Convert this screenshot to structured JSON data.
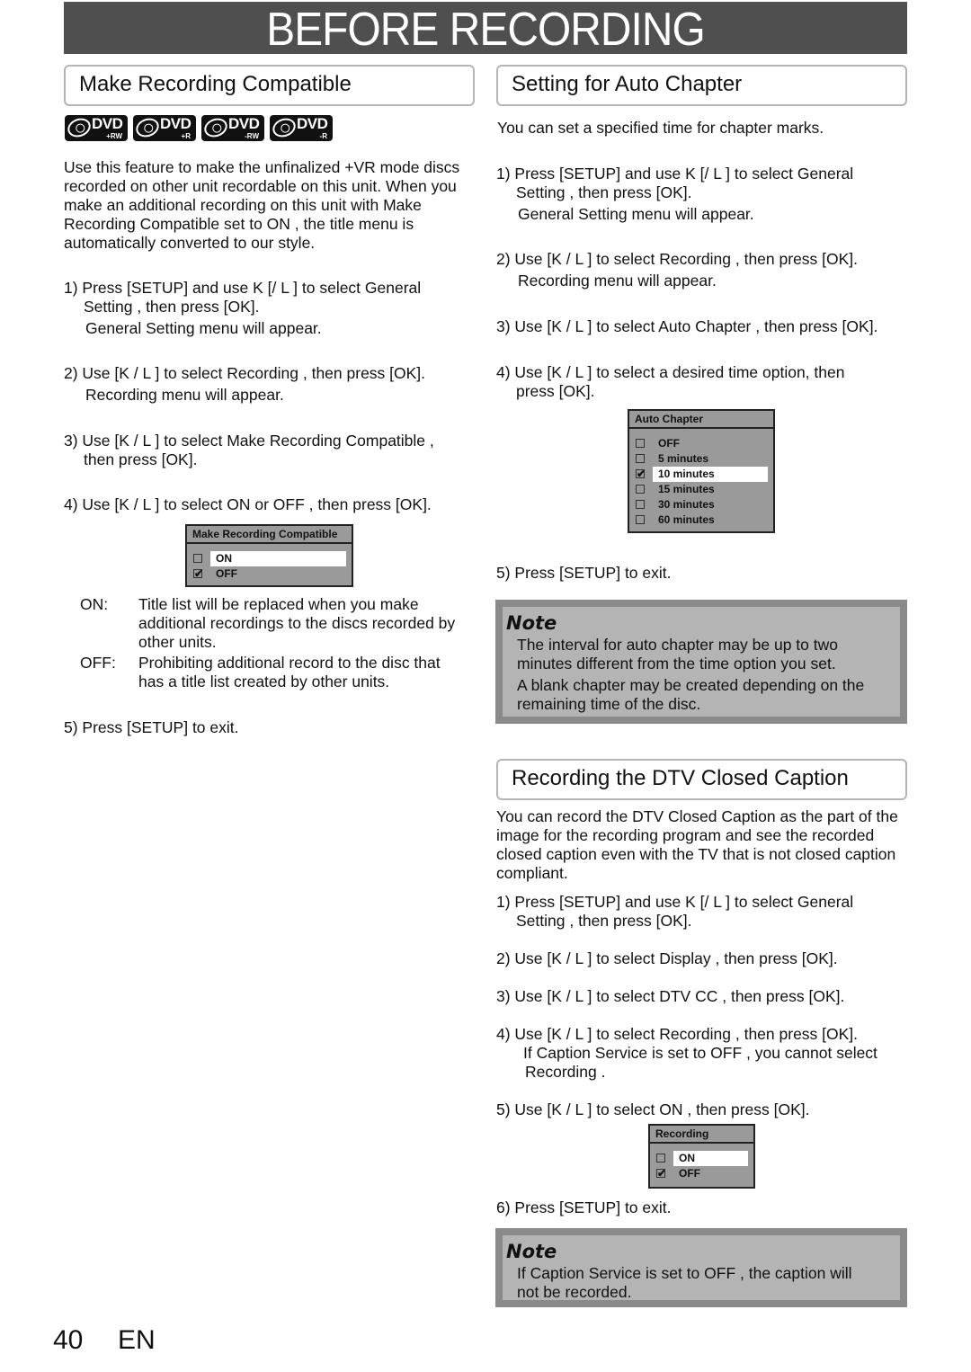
{
  "header": {
    "title": "BEFORE RECORDING"
  },
  "left": {
    "heading": "Make Recording Compatible",
    "disc_icons": [
      {
        "name": "dvd-plus-rw-icon",
        "label": "DVD",
        "sub": "+RW"
      },
      {
        "name": "dvd-plus-r-icon",
        "label": "DVD",
        "sub": "+R"
      },
      {
        "name": "dvd-minus-rw-icon",
        "label": "DVD",
        "sub": "-RW"
      },
      {
        "name": "dvd-minus-r-icon",
        "label": "DVD",
        "sub": "-R"
      }
    ],
    "intro": [
      "Use this feature to make the unfinalized +VR mode discs",
      "recorded on other unit recordable on this unit. When you",
      "make an additional recording on this unit with  Make",
      "Recording Compatible  set to  ON , the title menu is",
      "automatically converted to our style."
    ],
    "steps": [
      {
        "lines": [
          "1) Press [SETUP] and use K [/ L ] to select  General",
          "Setting , then press [OK].",
          "General Setting  menu will appear."
        ]
      },
      {
        "lines": [
          "2) Use [K / L ] to select  Recording , then press [OK].",
          "Recording  menu will appear."
        ]
      },
      {
        "lines": [
          "3) Use [K / L ] to select  Make Recording Compatible ,",
          "then press [OK]."
        ]
      },
      {
        "lines": [
          "4) Use [K / L ] to select  ON  or  OFF , then press [OK]."
        ]
      }
    ],
    "menu": {
      "title": "Make Recording Compatible",
      "options": [
        {
          "label": "ON",
          "checked": false,
          "highlighted": true
        },
        {
          "label": "OFF",
          "checked": true,
          "highlighted": false
        }
      ]
    },
    "defs": [
      {
        "term": "ON:",
        "desc": [
          "Title list will be replaced when you make",
          "additional recordings to the discs recorded by",
          "other units."
        ]
      },
      {
        "term": "OFF:",
        "desc": [
          "Prohibiting additional record to the disc that",
          "has a title list created by other units."
        ]
      }
    ],
    "exit": "5) Press [SETUP] to exit."
  },
  "right": {
    "heading": "Setting for Auto Chapter",
    "intro": "You can set a specified time for chapter marks.",
    "steps": [
      {
        "lines": [
          "1) Press [SETUP] and use K [/ L ] to select  General",
          "Setting , then press [OK].",
          "General Setting  menu will appear."
        ]
      },
      {
        "lines": [
          "2) Use [K / L ] to select  Recording , then press [OK].",
          "Recording  menu will appear."
        ]
      },
      {
        "lines": [
          "3) Use [K / L ] to select  Auto Chapter , then press [OK]."
        ]
      },
      {
        "lines": [
          "4) Use [K / L ] to select a desired time option, then",
          "press [OK]."
        ]
      }
    ],
    "menu": {
      "title": "Auto Chapter",
      "options": [
        {
          "label": "OFF",
          "checked": false,
          "highlighted": false
        },
        {
          "label": "5 minutes",
          "checked": false,
          "highlighted": false
        },
        {
          "label": "10 minutes",
          "checked": true,
          "highlighted": true
        },
        {
          "label": "15 minutes",
          "checked": false,
          "highlighted": false
        },
        {
          "label": "30 minutes",
          "checked": false,
          "highlighted": false
        },
        {
          "label": "60 minutes",
          "checked": false,
          "highlighted": false
        }
      ]
    },
    "exit": "5) Press [SETUP] to exit.",
    "note": {
      "title": "Note",
      "lines": [
        "The interval for auto chapter may be up to two",
        "minutes different from the time option you set.",
        "A blank chapter may be created depending on the",
        "remaining time of the disc."
      ]
    }
  },
  "dtv": {
    "heading": "Recording the DTV Closed Caption",
    "intro": [
      "You can record the DTV Closed Caption as the part of the",
      "image for the recording program and see the recorded",
      "closed caption even with the TV that is not closed caption",
      "compliant."
    ],
    "steps": [
      {
        "lines": [
          "1) Press [SETUP] and use K [/ L ] to select  General",
          "Setting , then press [OK]."
        ]
      },
      {
        "lines": [
          "2) Use [K / L ] to select  Display , then press [OK]."
        ]
      },
      {
        "lines": [
          "3) Use [K / L ] to select  DTV CC , then press [OK]."
        ]
      },
      {
        "lines": [
          "4) Use [K / L ] to select  Recording , then press [OK].",
          "If  Caption Service  is set to  OFF , you cannot select",
          "Recording ."
        ]
      },
      {
        "lines": [
          "5) Use [K / L ] to select  ON , then press [OK]."
        ]
      }
    ],
    "menu": {
      "title": "Recording",
      "options": [
        {
          "label": "ON",
          "checked": false,
          "highlighted": true
        },
        {
          "label": "OFF",
          "checked": true,
          "highlighted": false
        }
      ]
    },
    "exit": "6) Press [SETUP] to exit.",
    "note": {
      "title": "Note",
      "lines": [
        "If  Caption Service  is set to  OFF , the caption will",
        "not be recorded."
      ]
    }
  },
  "footer": {
    "page": "40",
    "lang": "EN"
  }
}
